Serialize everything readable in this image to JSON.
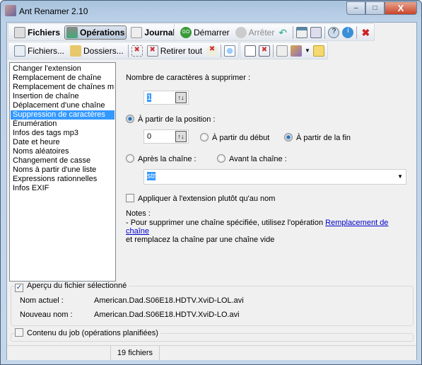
{
  "window": {
    "title": "Ant Renamer 2.10",
    "minimize": "–",
    "maximize": "□",
    "close": "X"
  },
  "toolbar1": {
    "files": "Fichiers",
    "operations": "Opérations",
    "journal": "Journal",
    "start": "Démarrer",
    "stop": "Arrêter"
  },
  "toolbar2": {
    "add_files": "Fichiers...",
    "add_folders": "Dossiers...",
    "remove_all": "Retirer tout"
  },
  "operations": [
    "Changer l'extension",
    "Remplacement de chaîne",
    "Remplacement de chaînes multiples",
    "Insertion de chaîne",
    "Déplacement d'une chaîne",
    "Suppression de caractères",
    "Énumération",
    "Infos des tags mp3",
    "Date et heure",
    "Noms aléatoires",
    "Changement de casse",
    "Noms à partir d'une liste",
    "Expressions rationnelles",
    "Infos EXIF"
  ],
  "selected_operation": "Suppression de caractères",
  "panel": {
    "count_label": "Nombre de caractères à supprimer :",
    "count_value": "1",
    "from_position": "À partir de la position :",
    "position_value": "0",
    "from_start": "À partir du début",
    "from_end": "À partir de la fin",
    "after_string": "Après la chaîne :",
    "before_string": "Avant la chaîne :",
    "string_value": "str",
    "apply_extension": "Appliquer à l'extension plutôt qu'au nom",
    "notes_title": "Notes :",
    "notes_text": "- Pour supprimer une chaîne spécifiée, utilisez l'opération",
    "notes_link": "Remplacement de chaîne",
    "notes_text2": "et remplacez la chaîne par une chaîne vide"
  },
  "preview": {
    "label": "Aperçu du fichier sélectionné",
    "checked": true,
    "current_label": "Nom actuel :",
    "current_value": "American.Dad.S06E18.HDTV.XviD-LOL.avi",
    "new_label": "Nouveau nom :",
    "new_value": "American.Dad.S06E18.HDTV.XviD-LO.avi"
  },
  "job": {
    "label": "Contenu du job (opérations planifiées)",
    "checked": false
  },
  "status": {
    "file_count": "19 fichiers"
  }
}
